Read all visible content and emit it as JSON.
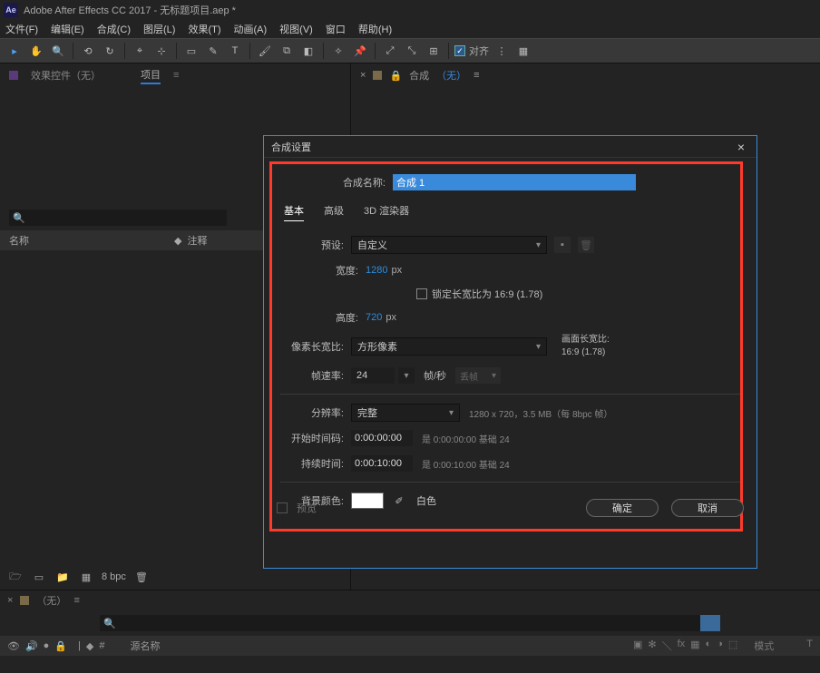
{
  "window": {
    "title": "Adobe After Effects CC 2017 - 无标题项目.aep *"
  },
  "menu": {
    "file": "文件(F)",
    "edit": "编辑(E)",
    "composition": "合成(C)",
    "layer": "图层(L)",
    "effect": "效果(T)",
    "animation": "动画(A)",
    "view": "视图(V)",
    "window": "窗口",
    "help": "帮助(H)"
  },
  "toolbar": {
    "snap": "对齐"
  },
  "panels": {
    "effects_tab": "效果控件（无）",
    "project_tab": "项目",
    "eq": "≡",
    "name_col": "名称",
    "comment_col": "注释",
    "tag_icon": "◆",
    "bpc": "8 bpc"
  },
  "viewer": {
    "x": "×",
    "lock": "🔒",
    "comp": "合成",
    "none": "（无）",
    "eq": "≡"
  },
  "timeline": {
    "x": "×",
    "none_tab": "（无）",
    "eq": "≡",
    "source_name": "源名称",
    "mode": "模式",
    "t": "T"
  },
  "dialog": {
    "title": "合成设置",
    "close": "×",
    "name_label": "合成名称:",
    "name_value": "合成 1",
    "tabs": {
      "basic": "基本",
      "advanced": "高级",
      "renderer": "3D 渲染器"
    },
    "preset_label": "预设:",
    "preset_value": "自定义",
    "width_label": "宽度:",
    "width_value": "1280",
    "height_label": "高度:",
    "height_value": "720",
    "px": "px",
    "lock_aspect": "锁定长宽比为 16:9 (1.78)",
    "par_label": "像素长宽比:",
    "par_value": "方形像素",
    "frame_aspect_label": "画面长宽比:",
    "frame_aspect_value": "16:9 (1.78)",
    "fps_label": "帧速率:",
    "fps_value": "24",
    "fps_unit": "帧/秒",
    "drop_label": "丢帧",
    "resolution_label": "分辨率:",
    "resolution_value": "完整",
    "resolution_hint": "1280 x 720，3.5 MB（每 8bpc 帧）",
    "start_label": "开始时间码:",
    "start_value": "0:00:00:00",
    "start_hint": "是 0:00:00:00  基础 24",
    "duration_label": "持续时间:",
    "duration_value": "0:00:10:00",
    "duration_hint": "是 0:00:10:00  基础 24",
    "bg_label": "背景颜色:",
    "bg_name": "白色",
    "preview": "预览",
    "ok": "确定",
    "cancel": "取消"
  }
}
